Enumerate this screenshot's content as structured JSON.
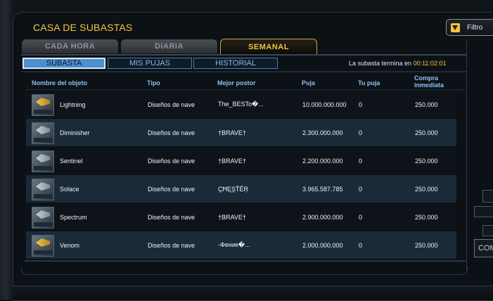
{
  "window": {
    "title": "CASA DE SUBASTAS"
  },
  "filter": {
    "label": "Filtro",
    "icon": "funnel-icon"
  },
  "tabs": [
    {
      "label": "CADA HORA",
      "active": false
    },
    {
      "label": "DIARIA",
      "active": false
    },
    {
      "label": "SEMANAL",
      "active": true
    }
  ],
  "subtabs": [
    {
      "label": "SUBASTA",
      "active": true
    },
    {
      "label": "MIS PUJAS",
      "active": false
    },
    {
      "label": "HISTORIAL",
      "active": false
    }
  ],
  "auction_end": {
    "label": "La subasta termina en",
    "time": "00:11:02:01"
  },
  "columns": {
    "name": "Nombre del objeto",
    "type": "Tipo",
    "top_bidder": "Mejor postor",
    "bid": "Puja",
    "your_bid": "Tu puja",
    "buy_now": "Compra inmediata"
  },
  "rows": [
    {
      "name": "Lightning",
      "type": "Diseños de nave",
      "top_bidder": "The_BESTo�...",
      "bid": "10.000.000.000",
      "your_bid": "0",
      "buy_now": "250.000"
    },
    {
      "name": "Diminisher",
      "type": "Diseños de nave",
      "top_bidder": "†BRAVE†",
      "bid": "2.300.000.000",
      "your_bid": "0",
      "buy_now": "250.000"
    },
    {
      "name": "Sentinel",
      "type": "Diseños de nave",
      "top_bidder": "†BRAVE†",
      "bid": "2.200.000.000",
      "your_bid": "0",
      "buy_now": "250.000"
    },
    {
      "name": "Solace",
      "type": "Diseños de nave",
      "top_bidder": "ÇĦĘŞŤĚŖ",
      "bid": "3.965.587.785",
      "your_bid": "0",
      "buy_now": "250.000"
    },
    {
      "name": "Spectrum",
      "type": "Diseños de nave",
      "top_bidder": "†BRAVE†",
      "bid": "2.900.000.000",
      "your_bid": "0",
      "buy_now": "250.000"
    },
    {
      "name": "Venom",
      "type": "Diseños de nave",
      "top_bidder": "-Феник�...",
      "bid": "2.000.000.000",
      "your_bid": "0",
      "buy_now": "250.000"
    }
  ],
  "right_panel": {
    "button_label": "COM"
  },
  "colors": {
    "accent": "#f2c53d",
    "header": "#8cc0ef",
    "row_alt": "#1b2a38"
  }
}
